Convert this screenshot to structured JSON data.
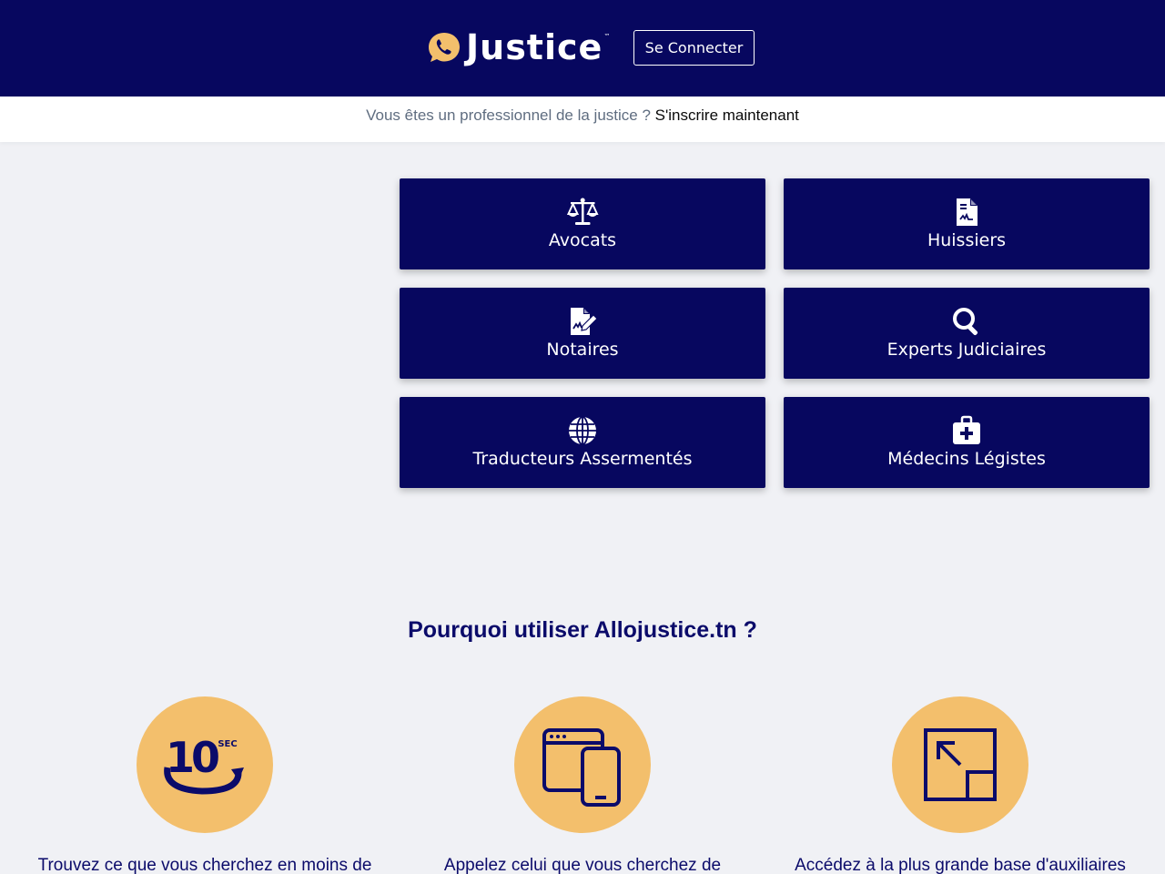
{
  "header": {
    "logo_text": "Justice",
    "logo_tm": "™",
    "login_label": "Se Connecter"
  },
  "subbar": {
    "question": "Vous êtes un professionnel de la justice ?",
    "link": "S'inscrire maintenant"
  },
  "categories": [
    {
      "label": "Avocats",
      "icon": "scale-balance-icon"
    },
    {
      "label": "Huissiers",
      "icon": "document-signature-icon"
    },
    {
      "label": "Notaires",
      "icon": "file-pen-icon"
    },
    {
      "label": "Experts Judiciaires",
      "icon": "search-icon"
    },
    {
      "label": "Traducteurs Assermentés",
      "icon": "globe-icon"
    },
    {
      "label": "Médecins Légistes",
      "icon": "medical-kit-icon"
    }
  ],
  "why": {
    "title": "Pourquoi utiliser Allojustice.tn ?",
    "features": [
      {
        "text": "Trouvez ce que vous cherchez en moins de",
        "icon": "ten-seconds-icon",
        "icon_number": "10",
        "icon_unit": "SEC"
      },
      {
        "text": "Appelez celui que vous cherchez de",
        "icon": "devices-icon"
      },
      {
        "text": "Accédez à la plus grande base d'auxiliaires",
        "icon": "expand-icon"
      }
    ]
  },
  "colors": {
    "navy": "#07075f",
    "accent": "#f3bf6c",
    "background": "#f0f1f5"
  }
}
